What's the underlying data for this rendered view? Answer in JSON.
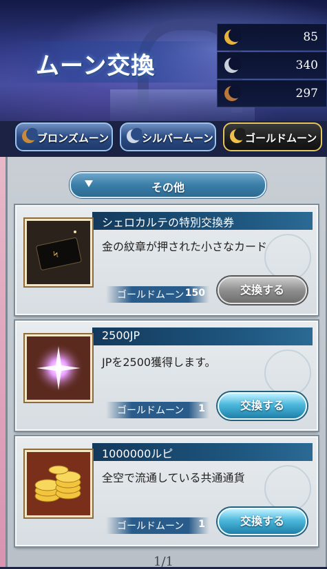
{
  "header": {
    "title": "ムーン交換",
    "counters": [
      {
        "name": "gold-moon",
        "value": "85",
        "color": "#e8b23a"
      },
      {
        "name": "silver-moon",
        "value": "340",
        "color": "#c8d0dc"
      },
      {
        "name": "bronze-moon",
        "value": "297",
        "color": "#b9773a"
      }
    ]
  },
  "tabs": [
    {
      "label": "ブロンズムーン",
      "color": "#c98a3a",
      "active": false
    },
    {
      "label": "シルバームーン",
      "color": "#cfd8e6",
      "active": false
    },
    {
      "label": "ゴールドムーン",
      "color": "#f0c04a",
      "active": true
    }
  ],
  "filter": {
    "label": "その他"
  },
  "items": [
    {
      "name": "シェロカルテの特別交換券",
      "description": "金の紋章が押された小さなカード",
      "currency": "ゴールドムーン",
      "cost": "150",
      "button": "交換する",
      "enabled": false,
      "icon": "card-icon"
    },
    {
      "name": "2500JP",
      "description": "JPを2500獲得します。",
      "currency": "ゴールドムーン",
      "cost": "1",
      "button": "交換する",
      "enabled": true,
      "icon": "sparkle-orb-icon"
    },
    {
      "name": "1000000ルピ",
      "description": "全空で流通している共通通貨",
      "currency": "ゴールドムーン",
      "cost": "1",
      "button": "交換する",
      "enabled": true,
      "icon": "gold-coins-icon"
    }
  ],
  "pager": {
    "text": "1/1"
  }
}
